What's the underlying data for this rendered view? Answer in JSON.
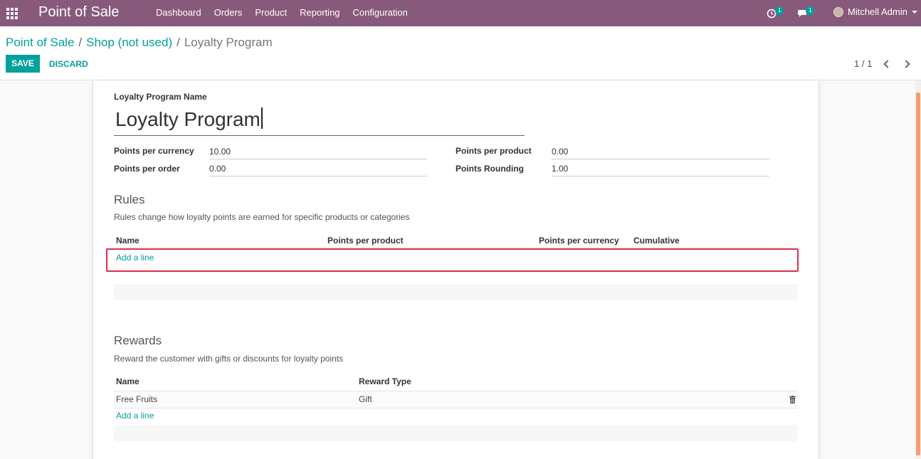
{
  "navbar": {
    "app_name": "Point of Sale",
    "menu": [
      "Dashboard",
      "Orders",
      "Product",
      "Reporting",
      "Configuration"
    ],
    "activity_count": "1",
    "message_count": "1",
    "user_name": "Mitchell Admin"
  },
  "breadcrumb": {
    "items": [
      "Point of Sale",
      "Shop (not used)"
    ],
    "separator": "/",
    "current": "Loyalty Program"
  },
  "toolbar": {
    "save_label": "SAVE",
    "discard_label": "DISCARD",
    "pager": "1 / 1"
  },
  "form": {
    "name_label": "Loyalty Program Name",
    "name_value": "Loyalty Program",
    "points_per_currency_label": "Points per currency",
    "points_per_currency_value": "10.00",
    "points_per_order_label": "Points per order",
    "points_per_order_value": "0.00",
    "points_per_product_label": "Points per product",
    "points_per_product_value": "0.00",
    "points_rounding_label": "Points Rounding",
    "points_rounding_value": "1.00"
  },
  "rules": {
    "title": "Rules",
    "description": "Rules change how loyalty points are earned for specific products or categories",
    "columns": [
      "Name",
      "Points per product",
      "Points per currency",
      "Cumulative"
    ],
    "add_line_label": "Add a line"
  },
  "rewards": {
    "title": "Rewards",
    "description": "Reward the customer with gifts or discounts for loyalty points",
    "columns": [
      "Name",
      "Reward Type"
    ],
    "rows": [
      {
        "name": "Free Fruits",
        "reward_type": "Gift"
      }
    ],
    "add_line_label": "Add a line"
  },
  "colors": {
    "navbar": "#875a7b",
    "accent": "#00a09d",
    "highlight": "#d9304f"
  },
  "icons": {
    "apps": "apps-grid-icon",
    "activity": "clock-icon",
    "messages": "chat-icon",
    "delete": "trash-icon"
  }
}
